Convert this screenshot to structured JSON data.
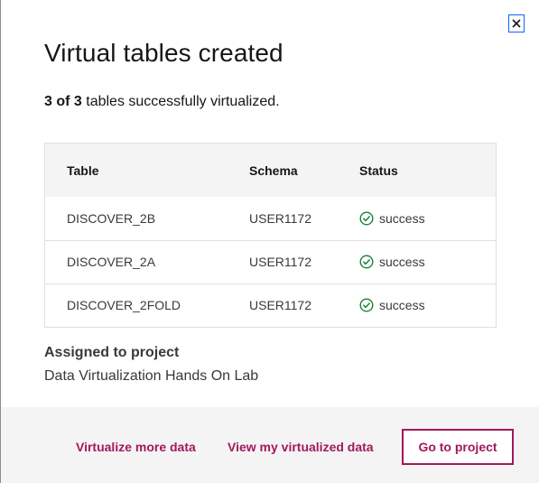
{
  "modal": {
    "title": "Virtual tables created",
    "summary": {
      "count_bold": "3 of 3",
      "text": " tables successfully virtualized."
    },
    "close_label": "Close"
  },
  "table": {
    "headers": [
      "Table",
      "Schema",
      "Status"
    ],
    "rows": [
      {
        "table": "DISCOVER_2B",
        "schema": "USER1172",
        "status": "success"
      },
      {
        "table": "DISCOVER_2A",
        "schema": "USER1172",
        "status": "success"
      },
      {
        "table": "DISCOVER_2FOLD",
        "schema": "USER1172",
        "status": "success"
      }
    ]
  },
  "project": {
    "label": "Assigned to project",
    "name": "Data Virtualization Hands On Lab"
  },
  "footer": {
    "virtualize_more": "Virtualize more data",
    "view_virtualized": "View my virtualized data",
    "go_to_project": "Go to project"
  },
  "icons": {
    "close": "close-icon",
    "status_success": "checkmark-outline-icon"
  },
  "colors": {
    "accent": "#a2195b",
    "success": "#198038",
    "focus": "#0f62fe"
  }
}
